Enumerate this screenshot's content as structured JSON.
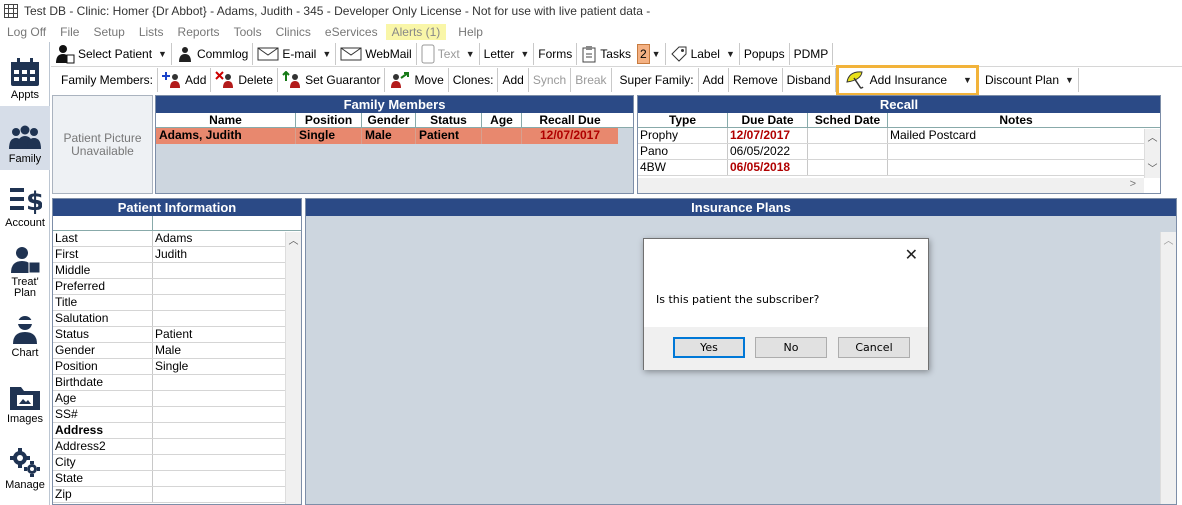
{
  "window": {
    "title": "Test DB - Clinic: Homer {Dr Abbot} - Adams, Judith - 345 - Developer Only License - Not for use with live patient data -"
  },
  "menu": [
    "Log Off",
    "File",
    "Setup",
    "Lists",
    "Reports",
    "Tools",
    "Clinics",
    "eServices"
  ],
  "menu_alert": "Alerts (1)",
  "menu_help": "Help",
  "nav": {
    "appts": "Appts",
    "family": "Family",
    "account": "Account",
    "treat1": "Treat'",
    "treat2": "Plan",
    "chart": "Chart",
    "images": "Images",
    "manage": "Manage"
  },
  "toolbar1": {
    "select_patient": "Select Patient",
    "commlog": "Commlog",
    "email": "E-mail",
    "webmail": "WebMail",
    "text": "Text",
    "letter": "Letter",
    "forms": "Forms",
    "tasks": "Tasks",
    "tasks_count": "2",
    "label": "Label",
    "popups": "Popups",
    "pdmp": "PDMP"
  },
  "toolbar2": {
    "family_members": "Family Members:",
    "add": "Add",
    "delete": "Delete",
    "set_guarantor": "Set Guarantor",
    "move": "Move",
    "clones": "Clones:",
    "clones_add": "Add",
    "synch": "Synch",
    "break": "Break",
    "super_family": "Super Family:",
    "sf_add": "Add",
    "sf_remove": "Remove",
    "sf_disband": "Disband",
    "add_insurance": "Add Insurance",
    "discount_plan": "Discount Plan"
  },
  "picture": {
    "line1": "Patient Picture",
    "line2": "Unavailable"
  },
  "family": {
    "title": "Family Members",
    "headers": [
      "Name",
      "Position",
      "Gender",
      "Status",
      "Age",
      "Recall Due"
    ],
    "row": {
      "name": "Adams, Judith",
      "position": "Single",
      "gender": "Male",
      "status": "Patient",
      "age": "",
      "recall": "12/07/2017"
    }
  },
  "recall": {
    "title": "Recall",
    "headers": [
      "Type",
      "Due Date",
      "Sched Date",
      "Notes"
    ],
    "rows": [
      {
        "type": "Prophy",
        "due": "12/07/2017",
        "sched": "",
        "notes": "Mailed Postcard"
      },
      {
        "type": "Pano",
        "due": "06/05/2022",
        "sched": "",
        "notes": ""
      },
      {
        "type": "4BW",
        "due": "06/05/2018",
        "sched": "",
        "notes": ""
      }
    ]
  },
  "patinfo": {
    "title": "Patient Information",
    "rows": [
      {
        "k": "Last",
        "v": "Adams"
      },
      {
        "k": "First",
        "v": "Judith"
      },
      {
        "k": "Middle",
        "v": ""
      },
      {
        "k": "Preferred",
        "v": ""
      },
      {
        "k": "Title",
        "v": ""
      },
      {
        "k": "Salutation",
        "v": ""
      },
      {
        "k": "Status",
        "v": "Patient"
      },
      {
        "k": "Gender",
        "v": "Male"
      },
      {
        "k": "Position",
        "v": "Single"
      },
      {
        "k": "Birthdate",
        "v": ""
      },
      {
        "k": "Age",
        "v": ""
      },
      {
        "k": "SS#",
        "v": ""
      },
      {
        "k": "Address",
        "v": ""
      },
      {
        "k": "Address2",
        "v": ""
      },
      {
        "k": "City",
        "v": ""
      },
      {
        "k": "State",
        "v": ""
      },
      {
        "k": "Zip",
        "v": ""
      }
    ]
  },
  "insurance": {
    "title": "Insurance Plans"
  },
  "dialog": {
    "message": "Is this patient the subscriber?",
    "yes": "Yes",
    "no": "No",
    "cancel": "Cancel"
  },
  "colors": {
    "header_blue": "#2b4a86",
    "selected_row": "#e8886e",
    "highlight_orange": "#f2b33a",
    "alert_yellow": "#f9f6a8"
  }
}
